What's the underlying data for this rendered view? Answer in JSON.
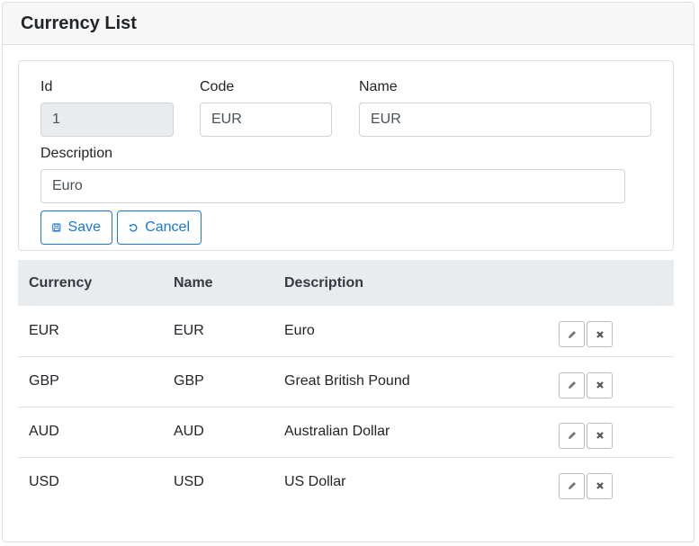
{
  "header": {
    "title": "Currency List"
  },
  "form": {
    "id_label": "Id",
    "id_value": "1",
    "code_label": "Code",
    "code_value": "EUR",
    "name_label": "Name",
    "name_value": "EUR",
    "description_label": "Description",
    "description_value": "Euro",
    "save_label": "Save",
    "cancel_label": "Cancel"
  },
  "table": {
    "headers": [
      "Currency",
      "Name",
      "Description"
    ],
    "rows": [
      {
        "currency": "EUR",
        "name": "EUR",
        "description": "Euro"
      },
      {
        "currency": "GBP",
        "name": "GBP",
        "description": "Great British Pound"
      },
      {
        "currency": "AUD",
        "name": "AUD",
        "description": "Australian Dollar"
      },
      {
        "currency": "USD",
        "name": "USD",
        "description": "US Dollar"
      }
    ],
    "row_actions": [
      "pencil-icon",
      "close-icon"
    ]
  },
  "colors": {
    "accent": "#1b77d2",
    "header_bg": "#f7f7f7",
    "table_head_bg": "#e9ecef",
    "readonly_bg": "#e9ecef"
  }
}
